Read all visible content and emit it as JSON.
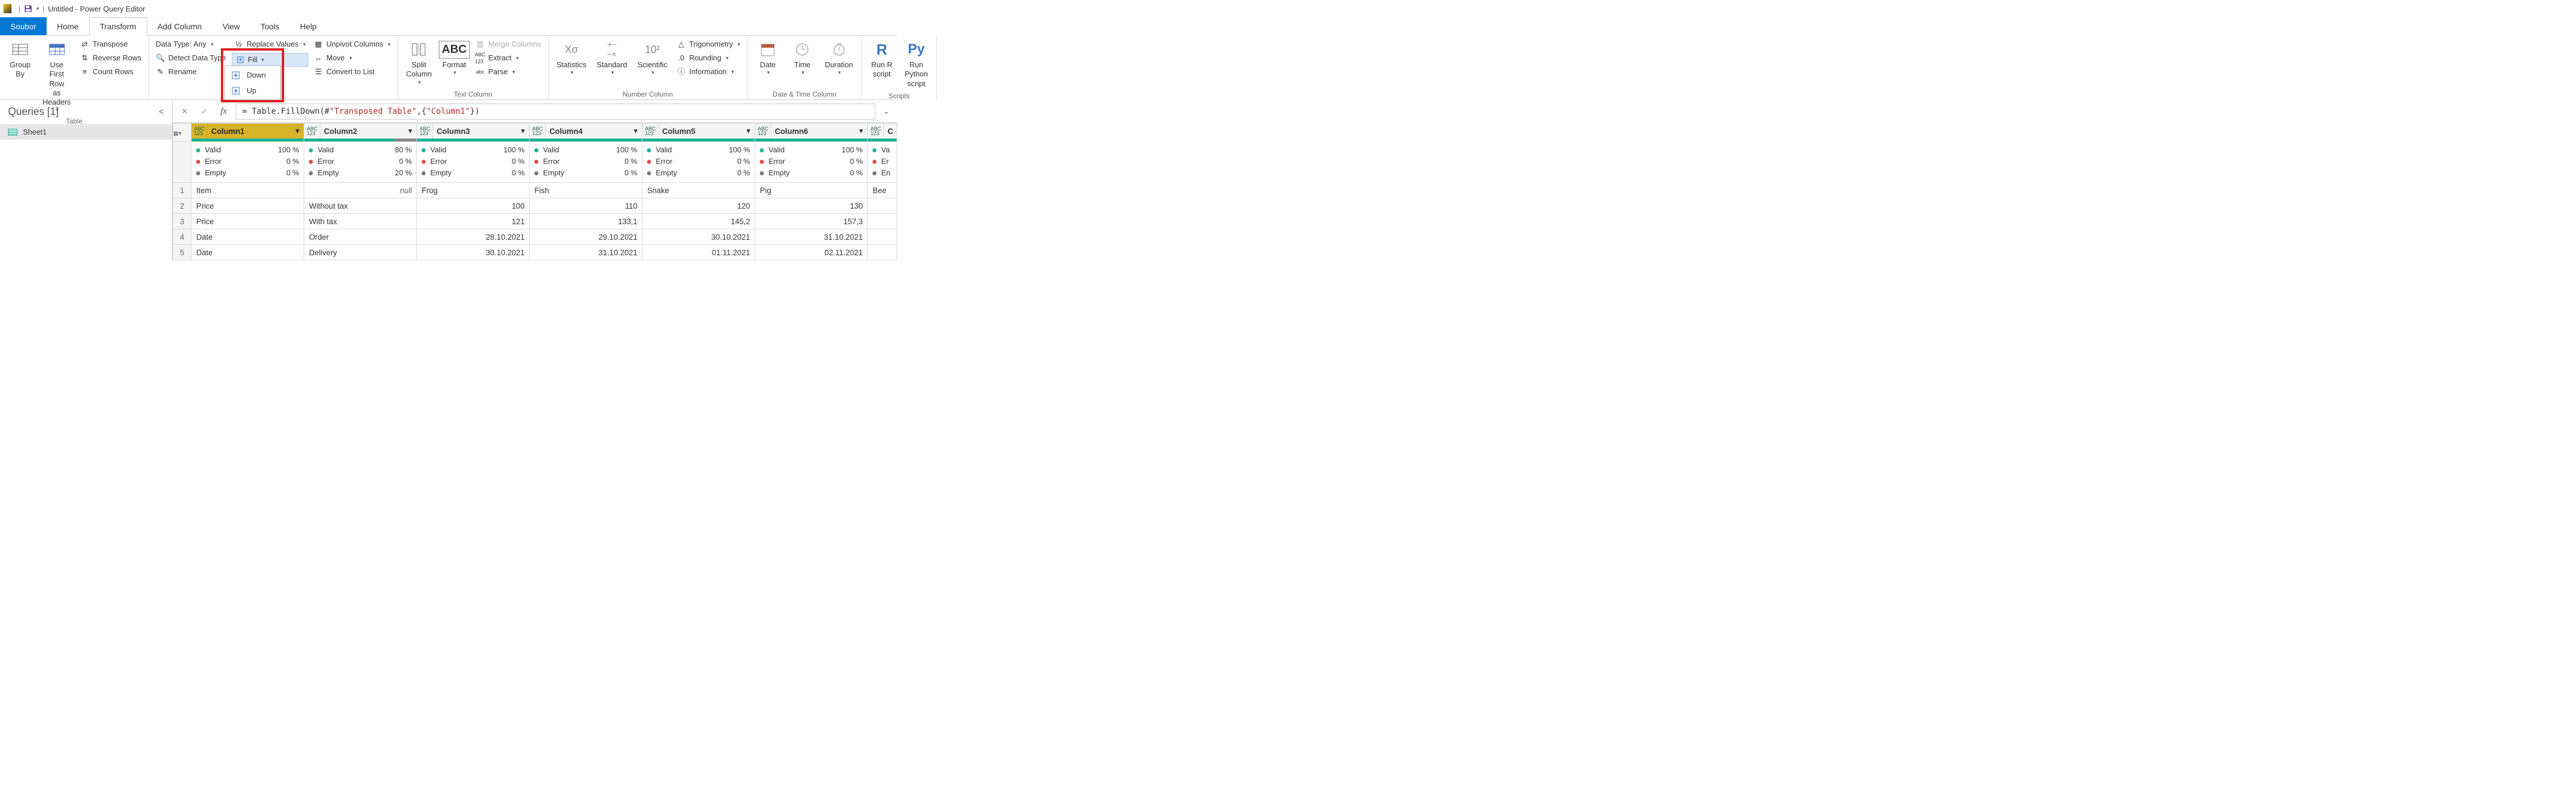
{
  "title": {
    "doc": "Untitled",
    "app": "Power Query Editor"
  },
  "tabs": {
    "file": "Soubor",
    "home": "Home",
    "transform": "Transform",
    "addcol": "Add Column",
    "view": "View",
    "tools": "Tools",
    "help": "Help"
  },
  "ribbon": {
    "table": {
      "group_by": "Group\nBy",
      "use_first_row": "Use First Row\nas Headers",
      "transpose": "Transpose",
      "reverse_rows": "Reverse Rows",
      "count_rows": "Count Rows",
      "label": "Table"
    },
    "anycol": {
      "data_type": "Data Type: Any",
      "detect": "Detect Data Type",
      "rename": "Rename",
      "replace": "Replace Values",
      "fill": "Fill",
      "fill_down": "Down",
      "fill_up": "Up",
      "unpivot": "Unpivot Columns",
      "move": "Move",
      "convert_list": "Convert to List"
    },
    "textcol": {
      "split": "Split\nColumn",
      "format": "Format",
      "merge": "Merge Columns",
      "extract": "Extract",
      "parse": "Parse",
      "label": "Text Column"
    },
    "numcol": {
      "statistics": "Statistics",
      "standard": "Standard",
      "scientific": "Scientific",
      "trig": "Trigonometry",
      "rounding": "Rounding",
      "info": "Information",
      "label": "Number Column"
    },
    "datetime": {
      "date": "Date",
      "time": "Time",
      "duration": "Duration",
      "label": "Date & Time Column"
    },
    "scripts": {
      "r": "Run R\nscript",
      "py": "Run Python\nscript",
      "label": "Scripts"
    }
  },
  "queries": {
    "header": "Queries [1]",
    "items": [
      "Sheet1"
    ]
  },
  "formula": {
    "prefix": "= Table.FillDown(#",
    "arg1": "\"Transposed Table\"",
    "mid": ",{",
    "arg2": "\"Column1\"",
    "suffix": "})"
  },
  "columns": [
    "Column1",
    "Column2",
    "Column3",
    "Column4",
    "Column5",
    "Column6"
  ],
  "partial_col_letters": "C",
  "stats_labels": {
    "valid": "Valid",
    "error": "Error",
    "empty": "Empty"
  },
  "stats": [
    {
      "valid": "100 %",
      "error": "0 %",
      "empty": "0 %"
    },
    {
      "valid": "80 %",
      "error": "0 %",
      "empty": "20 %"
    },
    {
      "valid": "100 %",
      "error": "0 %",
      "empty": "0 %"
    },
    {
      "valid": "100 %",
      "error": "0 %",
      "empty": "0 %"
    },
    {
      "valid": "100 %",
      "error": "0 %",
      "empty": "0 %"
    },
    {
      "valid": "100 %",
      "error": "0 %",
      "empty": "0 %"
    }
  ],
  "partial_stats": {
    "valid": "Va",
    "error": "Er",
    "empty": "En"
  },
  "rows": [
    {
      "n": "1",
      "cells": [
        "Item",
        null,
        "Frog",
        "Fish",
        "Snake",
        "Pig"
      ],
      "partial": "Bee",
      "align": [
        "l",
        "null",
        "l",
        "l",
        "l",
        "l"
      ]
    },
    {
      "n": "2",
      "cells": [
        "Price",
        "Without tax",
        "100",
        "110",
        "120",
        "130"
      ],
      "partial": "",
      "align": [
        "l",
        "l",
        "r",
        "r",
        "r",
        "r"
      ]
    },
    {
      "n": "3",
      "cells": [
        "Price",
        "With tax",
        "121",
        "133,1",
        "145,2",
        "157,3"
      ],
      "partial": "",
      "align": [
        "l",
        "l",
        "r",
        "r",
        "r",
        "r"
      ]
    },
    {
      "n": "4",
      "cells": [
        "Date",
        "Order",
        "28.10.2021",
        "29.10.2021",
        "30.10.2021",
        "31.10.2021"
      ],
      "partial": "",
      "align": [
        "l",
        "l",
        "r",
        "r",
        "r",
        "r"
      ]
    },
    {
      "n": "5",
      "cells": [
        "Date",
        "Delivery",
        "30.10.2021",
        "31.10.2021",
        "01.11.2021",
        "02.11.2021"
      ],
      "partial": "",
      "align": [
        "l",
        "l",
        "r",
        "r",
        "r",
        "r"
      ]
    }
  ]
}
